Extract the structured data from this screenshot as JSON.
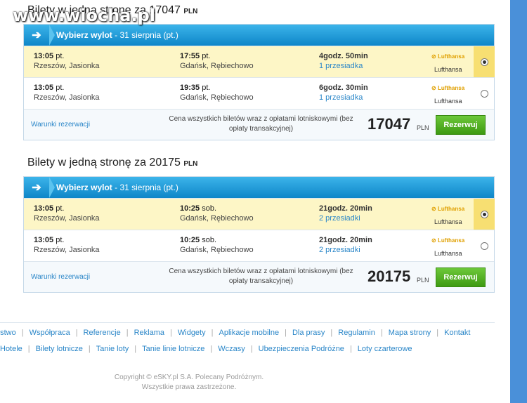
{
  "watermark": "www.wiocha.pl",
  "sections": [
    {
      "title": "Bilety w jedną stronę za 17047",
      "title_cur": "PLN",
      "header_bold": "Wybierz wylot",
      "header_date": " - 31 sierpnia (pt.)",
      "flights": [
        {
          "dep_time": "13:05",
          "dep_day": "pt.",
          "dep_place": "Rzeszów, Jasionka",
          "arr_time": "17:55",
          "arr_day": "pt.",
          "arr_place": "Gdańsk, Rębiechowo",
          "duration": "4godz. 50min",
          "stops": "1 przesiadka",
          "logo": "Lufthansa",
          "airline": "Lufthansa",
          "selected": true
        },
        {
          "dep_time": "13:05",
          "dep_day": "pt.",
          "dep_place": "Rzeszów, Jasionka",
          "arr_time": "19:35",
          "arr_day": "pt.",
          "arr_place": "Gdańsk, Rębiechowo",
          "duration": "6godz. 30min",
          "stops": "1 przesiadka",
          "logo": "Lufthansa",
          "airline": "Lufthansa",
          "selected": false
        }
      ],
      "conditions": "Warunki rezerwacji",
      "note": "Cena wszystkich biletów wraz z opłatami lotniskowymi (bez opłaty transakcyjnej)",
      "price": "17047",
      "price_cur": "PLN",
      "button": "Rezerwuj"
    },
    {
      "title": "Bilety w jedną stronę za 20175",
      "title_cur": "PLN",
      "header_bold": "Wybierz wylot",
      "header_date": " - 31 sierpnia (pt.)",
      "flights": [
        {
          "dep_time": "13:05",
          "dep_day": "pt.",
          "dep_place": "Rzeszów, Jasionka",
          "arr_time": "10:25",
          "arr_day": "sob.",
          "arr_place": "Gdańsk, Rębiechowo",
          "duration": "21godz. 20min",
          "stops": "2 przesiadki",
          "logo": "Lufthansa",
          "airline": "Lufthansa",
          "selected": true
        },
        {
          "dep_time": "13:05",
          "dep_day": "pt.",
          "dep_place": "Rzeszów, Jasionka",
          "arr_time": "10:25",
          "arr_day": "sob.",
          "arr_place": "Gdańsk, Rębiechowo",
          "duration": "21godz. 20min",
          "stops": "2 przesiadki",
          "logo": "Lufthansa",
          "airline": "Lufthansa",
          "selected": false
        }
      ],
      "conditions": "Warunki rezerwacji",
      "note": "Cena wszystkich biletów wraz z opłatami lotniskowymi (bez opłaty transakcyjnej)",
      "price": "20175",
      "price_cur": "PLN",
      "button": "Rezerwuj"
    }
  ],
  "footer_links_1": [
    "ństwo",
    "Współpraca",
    "Referencje",
    "Reklama",
    "Widgety",
    "Aplikacje mobilne",
    "Dla prasy",
    "Regulamin",
    "Mapa strony",
    "Kontakt"
  ],
  "footer_links_2": [
    "Hotele",
    "Bilety lotnicze",
    "Tanie loty",
    "Tanie linie lotnicze",
    "Wczasy",
    "Ubezpieczenia Podróżne",
    "Loty czarterowe"
  ],
  "copyright_1": "Copyright © eSKY.pl S.A. Polecany Podróżnym.",
  "copyright_2": "Wszystkie prawa zastrzeżone.",
  "colors": {
    "header": "#0e86c8",
    "selected_row": "#fdf6c6",
    "button": "#3e9a12",
    "link": "#2a86c8"
  }
}
